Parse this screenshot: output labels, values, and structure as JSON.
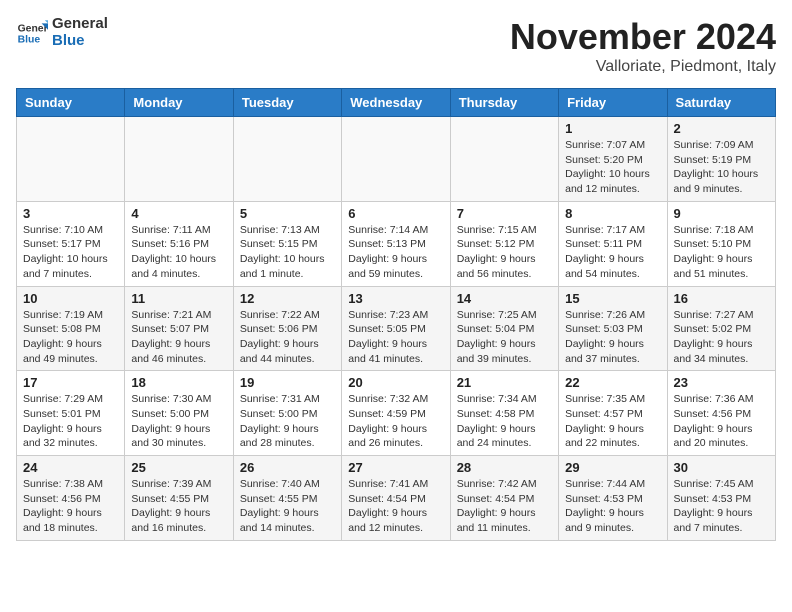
{
  "header": {
    "logo": {
      "general": "General",
      "blue": "Blue"
    },
    "title": "November 2024",
    "location": "Valloriate, Piedmont, Italy"
  },
  "weekdays": [
    "Sunday",
    "Monday",
    "Tuesday",
    "Wednesday",
    "Thursday",
    "Friday",
    "Saturday"
  ],
  "weeks": [
    [
      {
        "day": "",
        "info": ""
      },
      {
        "day": "",
        "info": ""
      },
      {
        "day": "",
        "info": ""
      },
      {
        "day": "",
        "info": ""
      },
      {
        "day": "",
        "info": ""
      },
      {
        "day": "1",
        "info": "Sunrise: 7:07 AM\nSunset: 5:20 PM\nDaylight: 10 hours and 12 minutes."
      },
      {
        "day": "2",
        "info": "Sunrise: 7:09 AM\nSunset: 5:19 PM\nDaylight: 10 hours and 9 minutes."
      }
    ],
    [
      {
        "day": "3",
        "info": "Sunrise: 7:10 AM\nSunset: 5:17 PM\nDaylight: 10 hours and 7 minutes."
      },
      {
        "day": "4",
        "info": "Sunrise: 7:11 AM\nSunset: 5:16 PM\nDaylight: 10 hours and 4 minutes."
      },
      {
        "day": "5",
        "info": "Sunrise: 7:13 AM\nSunset: 5:15 PM\nDaylight: 10 hours and 1 minute."
      },
      {
        "day": "6",
        "info": "Sunrise: 7:14 AM\nSunset: 5:13 PM\nDaylight: 9 hours and 59 minutes."
      },
      {
        "day": "7",
        "info": "Sunrise: 7:15 AM\nSunset: 5:12 PM\nDaylight: 9 hours and 56 minutes."
      },
      {
        "day": "8",
        "info": "Sunrise: 7:17 AM\nSunset: 5:11 PM\nDaylight: 9 hours and 54 minutes."
      },
      {
        "day": "9",
        "info": "Sunrise: 7:18 AM\nSunset: 5:10 PM\nDaylight: 9 hours and 51 minutes."
      }
    ],
    [
      {
        "day": "10",
        "info": "Sunrise: 7:19 AM\nSunset: 5:08 PM\nDaylight: 9 hours and 49 minutes."
      },
      {
        "day": "11",
        "info": "Sunrise: 7:21 AM\nSunset: 5:07 PM\nDaylight: 9 hours and 46 minutes."
      },
      {
        "day": "12",
        "info": "Sunrise: 7:22 AM\nSunset: 5:06 PM\nDaylight: 9 hours and 44 minutes."
      },
      {
        "day": "13",
        "info": "Sunrise: 7:23 AM\nSunset: 5:05 PM\nDaylight: 9 hours and 41 minutes."
      },
      {
        "day": "14",
        "info": "Sunrise: 7:25 AM\nSunset: 5:04 PM\nDaylight: 9 hours and 39 minutes."
      },
      {
        "day": "15",
        "info": "Sunrise: 7:26 AM\nSunset: 5:03 PM\nDaylight: 9 hours and 37 minutes."
      },
      {
        "day": "16",
        "info": "Sunrise: 7:27 AM\nSunset: 5:02 PM\nDaylight: 9 hours and 34 minutes."
      }
    ],
    [
      {
        "day": "17",
        "info": "Sunrise: 7:29 AM\nSunset: 5:01 PM\nDaylight: 9 hours and 32 minutes."
      },
      {
        "day": "18",
        "info": "Sunrise: 7:30 AM\nSunset: 5:00 PM\nDaylight: 9 hours and 30 minutes."
      },
      {
        "day": "19",
        "info": "Sunrise: 7:31 AM\nSunset: 5:00 PM\nDaylight: 9 hours and 28 minutes."
      },
      {
        "day": "20",
        "info": "Sunrise: 7:32 AM\nSunset: 4:59 PM\nDaylight: 9 hours and 26 minutes."
      },
      {
        "day": "21",
        "info": "Sunrise: 7:34 AM\nSunset: 4:58 PM\nDaylight: 9 hours and 24 minutes."
      },
      {
        "day": "22",
        "info": "Sunrise: 7:35 AM\nSunset: 4:57 PM\nDaylight: 9 hours and 22 minutes."
      },
      {
        "day": "23",
        "info": "Sunrise: 7:36 AM\nSunset: 4:56 PM\nDaylight: 9 hours and 20 minutes."
      }
    ],
    [
      {
        "day": "24",
        "info": "Sunrise: 7:38 AM\nSunset: 4:56 PM\nDaylight: 9 hours and 18 minutes."
      },
      {
        "day": "25",
        "info": "Sunrise: 7:39 AM\nSunset: 4:55 PM\nDaylight: 9 hours and 16 minutes."
      },
      {
        "day": "26",
        "info": "Sunrise: 7:40 AM\nSunset: 4:55 PM\nDaylight: 9 hours and 14 minutes."
      },
      {
        "day": "27",
        "info": "Sunrise: 7:41 AM\nSunset: 4:54 PM\nDaylight: 9 hours and 12 minutes."
      },
      {
        "day": "28",
        "info": "Sunrise: 7:42 AM\nSunset: 4:54 PM\nDaylight: 9 hours and 11 minutes."
      },
      {
        "day": "29",
        "info": "Sunrise: 7:44 AM\nSunset: 4:53 PM\nDaylight: 9 hours and 9 minutes."
      },
      {
        "day": "30",
        "info": "Sunrise: 7:45 AM\nSunset: 4:53 PM\nDaylight: 9 hours and 7 minutes."
      }
    ]
  ]
}
